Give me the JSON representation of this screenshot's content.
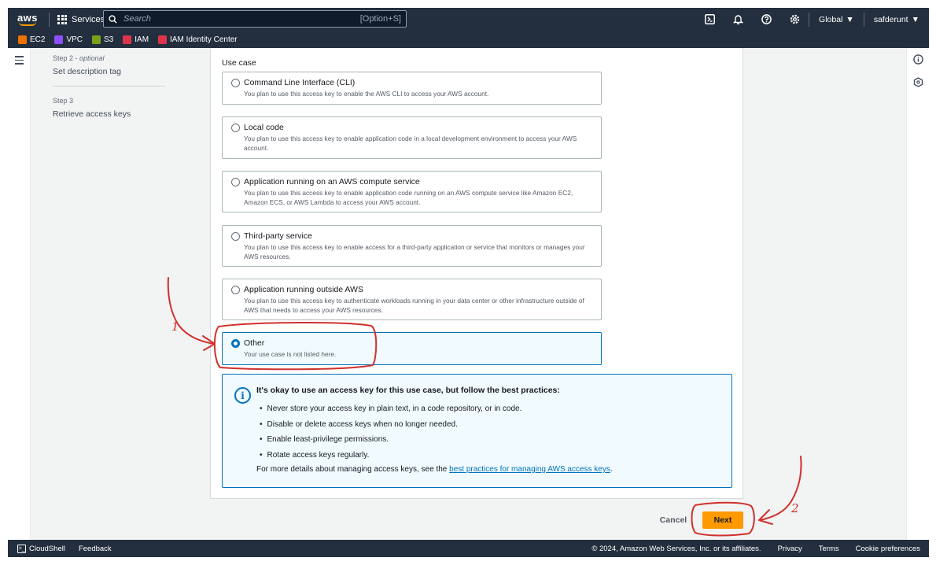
{
  "topnav": {
    "logo": "aws",
    "services_label": "Services",
    "search_placeholder": "Search",
    "search_shortcut": "[Option+S]",
    "region": "Global",
    "account": "safderunt"
  },
  "favorites": [
    {
      "label": "EC2",
      "color": "#ed7100"
    },
    {
      "label": "VPC",
      "color": "#8c4fff"
    },
    {
      "label": "S3",
      "color": "#7aa116"
    },
    {
      "label": "IAM",
      "color": "#dd344c"
    },
    {
      "label": "IAM Identity Center",
      "color": "#dd344c"
    }
  ],
  "steps": [
    {
      "number": "Step 2",
      "qualifier": "optional",
      "title": "Set description tag"
    },
    {
      "number": "Step 3",
      "title": "Retrieve access keys"
    }
  ],
  "use_case": {
    "label": "Use case",
    "options": [
      {
        "title": "Command Line Interface (CLI)",
        "desc": "You plan to use this access key to enable the AWS CLI to access your AWS account.",
        "selected": false
      },
      {
        "title": "Local code",
        "desc": "You plan to use this access key to enable application code in a local development environment to access your AWS account.",
        "selected": false
      },
      {
        "title": "Application running on an AWS compute service",
        "desc": "You plan to use this access key to enable application code running on an AWS compute service like Amazon EC2, Amazon ECS, or AWS Lambda to access your AWS account.",
        "selected": false
      },
      {
        "title": "Third-party service",
        "desc": "You plan to use this access key to enable access for a third-party application or service that monitors or manages your AWS resources.",
        "selected": false
      },
      {
        "title": "Application running outside AWS",
        "desc": "You plan to use this access key to authenticate workloads running in your data center or other infrastructure outside of AWS that needs to access your AWS resources.",
        "selected": false
      },
      {
        "title": "Other",
        "desc": "Your use case is not listed here.",
        "selected": true
      }
    ]
  },
  "info_alert": {
    "heading": "It's okay to use an access key for this use case, but follow the best practices:",
    "items": [
      "Never store your access key in plain text, in a code repository, or in code.",
      "Disable or delete access keys when no longer needed.",
      "Enable least-privilege permissions.",
      "Rotate access keys regularly."
    ],
    "more_prefix": "For more details about managing access keys, see the ",
    "more_link": "best practices for managing AWS access keys",
    "more_suffix": "."
  },
  "actions": {
    "cancel": "Cancel",
    "next": "Next"
  },
  "annotations": {
    "arrow1_label": "1",
    "arrow2_label": "2",
    "color": "#d0312d"
  },
  "footer": {
    "cloudshell": "CloudShell",
    "feedback": "Feedback",
    "copyright": "© 2024, Amazon Web Services, Inc. or its affiliates.",
    "links": [
      "Privacy",
      "Terms",
      "Cookie preferences"
    ]
  }
}
